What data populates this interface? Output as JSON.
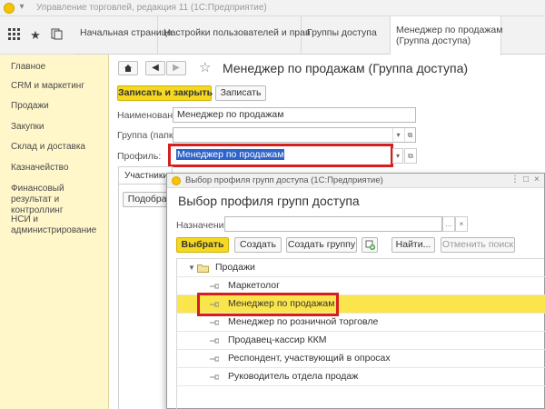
{
  "window": {
    "title": "Управление торговлей, редакция 11 (1С:Предприятие)"
  },
  "toolbar": {
    "apps_icon": "apps-grid-icon",
    "favorites_icon": "star-icon",
    "history_icon": "history-icon"
  },
  "tabs": [
    {
      "label": "Начальная страница"
    },
    {
      "label": "Настройки пользователей и прав"
    },
    {
      "label": "Группы доступа"
    },
    {
      "label_line1": "Менеджер по продажам",
      "label_line2": "(Группа доступа)"
    }
  ],
  "sidebar": {
    "items": [
      {
        "label": "Главное"
      },
      {
        "label": "CRM и маркетинг"
      },
      {
        "label": "Продажи"
      },
      {
        "label": "Закупки"
      },
      {
        "label": "Склад и доставка"
      },
      {
        "label": "Казначейство"
      },
      {
        "label": "Финансовый результат и контроллинг"
      },
      {
        "label": "НСИ и администрирование"
      }
    ]
  },
  "form": {
    "home_icon": "home-icon",
    "back_icon": "back-arrow-icon",
    "forward_icon": "forward-arrow-icon",
    "title": "Менеджер по продажам (Группа доступа)",
    "save_close_label": "Записать и закрыть",
    "save_label": "Записать",
    "name_label": "Наименование:",
    "name_value": "Менеджер по продажам",
    "group_label": "Группа (папка):",
    "group_value": "",
    "profile_label": "Профиль:",
    "profile_value": "Менеджер по продажам",
    "members_tab": "Участники гр",
    "pick_button": "Подобрат"
  },
  "dialog": {
    "window_title": "Выбор профиля групп доступа  (1С:Предприятие)",
    "heading": "Выбор профиля групп доступа",
    "purpose_label": "Назначение:",
    "purpose_value": "",
    "select_label": "Выбрать",
    "create_label": "Создать",
    "create_group_label": "Создать группу",
    "find_label": "Найти...",
    "cancel_search_label": "Отменить поиск",
    "tree": {
      "group": "Продажи",
      "items": [
        {
          "label": "Маркетолог",
          "selected": false
        },
        {
          "label": "Менеджер по продажам",
          "selected": true
        },
        {
          "label": "Менеджер по розничной торговле",
          "selected": false
        },
        {
          "label": "Продавец-кассир ККМ",
          "selected": false
        },
        {
          "label": "Респондент, участвующий в опросах",
          "selected": false
        },
        {
          "label": "Руководитель отдела продаж",
          "selected": false
        }
      ]
    }
  },
  "colors": {
    "accent_yellow": "#f5d823",
    "sidebar_bg": "#fff6c9",
    "selection_yellow": "#fbe54d",
    "highlight_red": "#d61e1e",
    "text_selection_blue": "#2e63c9"
  }
}
